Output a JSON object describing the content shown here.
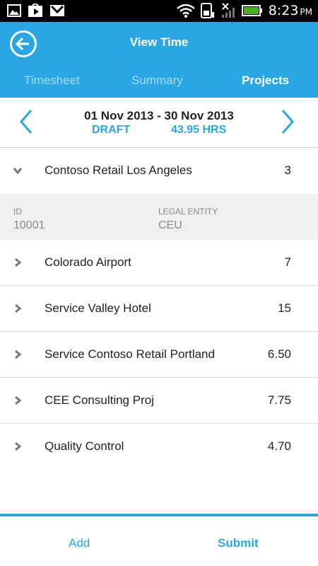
{
  "status_bar": {
    "time": "8:23",
    "ampm": "PM",
    "left_icons": [
      "image-icon",
      "play-store-icon",
      "gmail-icon"
    ],
    "right_icons": [
      "wifi-icon",
      "sim-icon",
      "no-signal-icon",
      "battery-icon"
    ]
  },
  "header": {
    "title": "View Time",
    "tabs": [
      {
        "label": "Timesheet",
        "active": false
      },
      {
        "label": "Summary",
        "active": false
      },
      {
        "label": "Projects",
        "active": true
      }
    ]
  },
  "period": {
    "dates": "01 Nov 2013 - 30 Nov 2013",
    "status": "DRAFT",
    "hours": "43.95 HRS"
  },
  "projects": [
    {
      "name": "Contoso Retail Los Angeles",
      "value": "3",
      "expanded": true,
      "details": {
        "id_label": "ID",
        "id_value": "10001",
        "entity_label": "LEGAL ENTITY",
        "entity_value": "CEU"
      }
    },
    {
      "name": "Colorado Airport",
      "value": "7",
      "expanded": false
    },
    {
      "name": "Service Valley Hotel",
      "value": "15",
      "expanded": false
    },
    {
      "name": "Service Contoso Retail Portland",
      "value": "6.50",
      "expanded": false
    },
    {
      "name": "CEE Consulting Proj",
      "value": "7.75",
      "expanded": false
    },
    {
      "name": "Quality Control",
      "value": "4.70",
      "expanded": false
    }
  ],
  "footer": {
    "add_label": "Add",
    "submit_label": "Submit"
  },
  "colors": {
    "accent": "#2aa7e3",
    "tab_inactive": "#a9dcf5",
    "details_bg": "#efefef"
  }
}
